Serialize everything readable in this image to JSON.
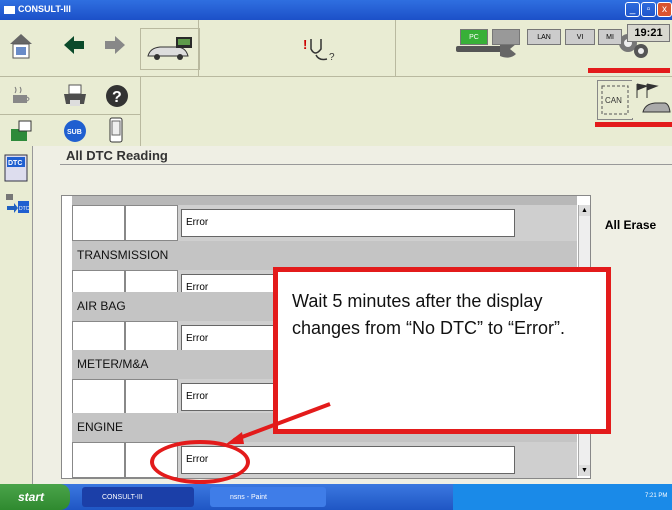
{
  "window": {
    "title": "CONSULT-III"
  },
  "status": {
    "pc": "PC",
    "lan": "LAN",
    "vi": "VI",
    "mi": "MI",
    "time": "19:21"
  },
  "toolbar": {
    "sub_label": "SUB",
    "can_label": "CAN"
  },
  "sidebar": {
    "dtc_label": "DTC",
    "dtc_erase_label": "DTC"
  },
  "page": {
    "title": "All DTC Reading"
  },
  "table": {
    "first_status": "Error",
    "systems": [
      {
        "name": "TRANSMISSION",
        "status": "Error"
      },
      {
        "name": "AIR BAG",
        "status": "Error"
      },
      {
        "name": "METER/M&A",
        "status": "Error"
      },
      {
        "name": "ENGINE",
        "status": "Error"
      }
    ]
  },
  "buttons": {
    "all_erase": "All Erase"
  },
  "callout": {
    "text": "Wait 5 minutes after the display changes from “No DTC” to “Error”."
  },
  "taskbar": {
    "start": "start",
    "task1": "CONSULT-III",
    "task2": "nsns - Paint",
    "tray_time": "7:21 PM"
  },
  "colors": {
    "callout_border": "#e31b1b",
    "titlebar": "#1c50c8",
    "toolbar_bg": "#e9ecd3"
  }
}
